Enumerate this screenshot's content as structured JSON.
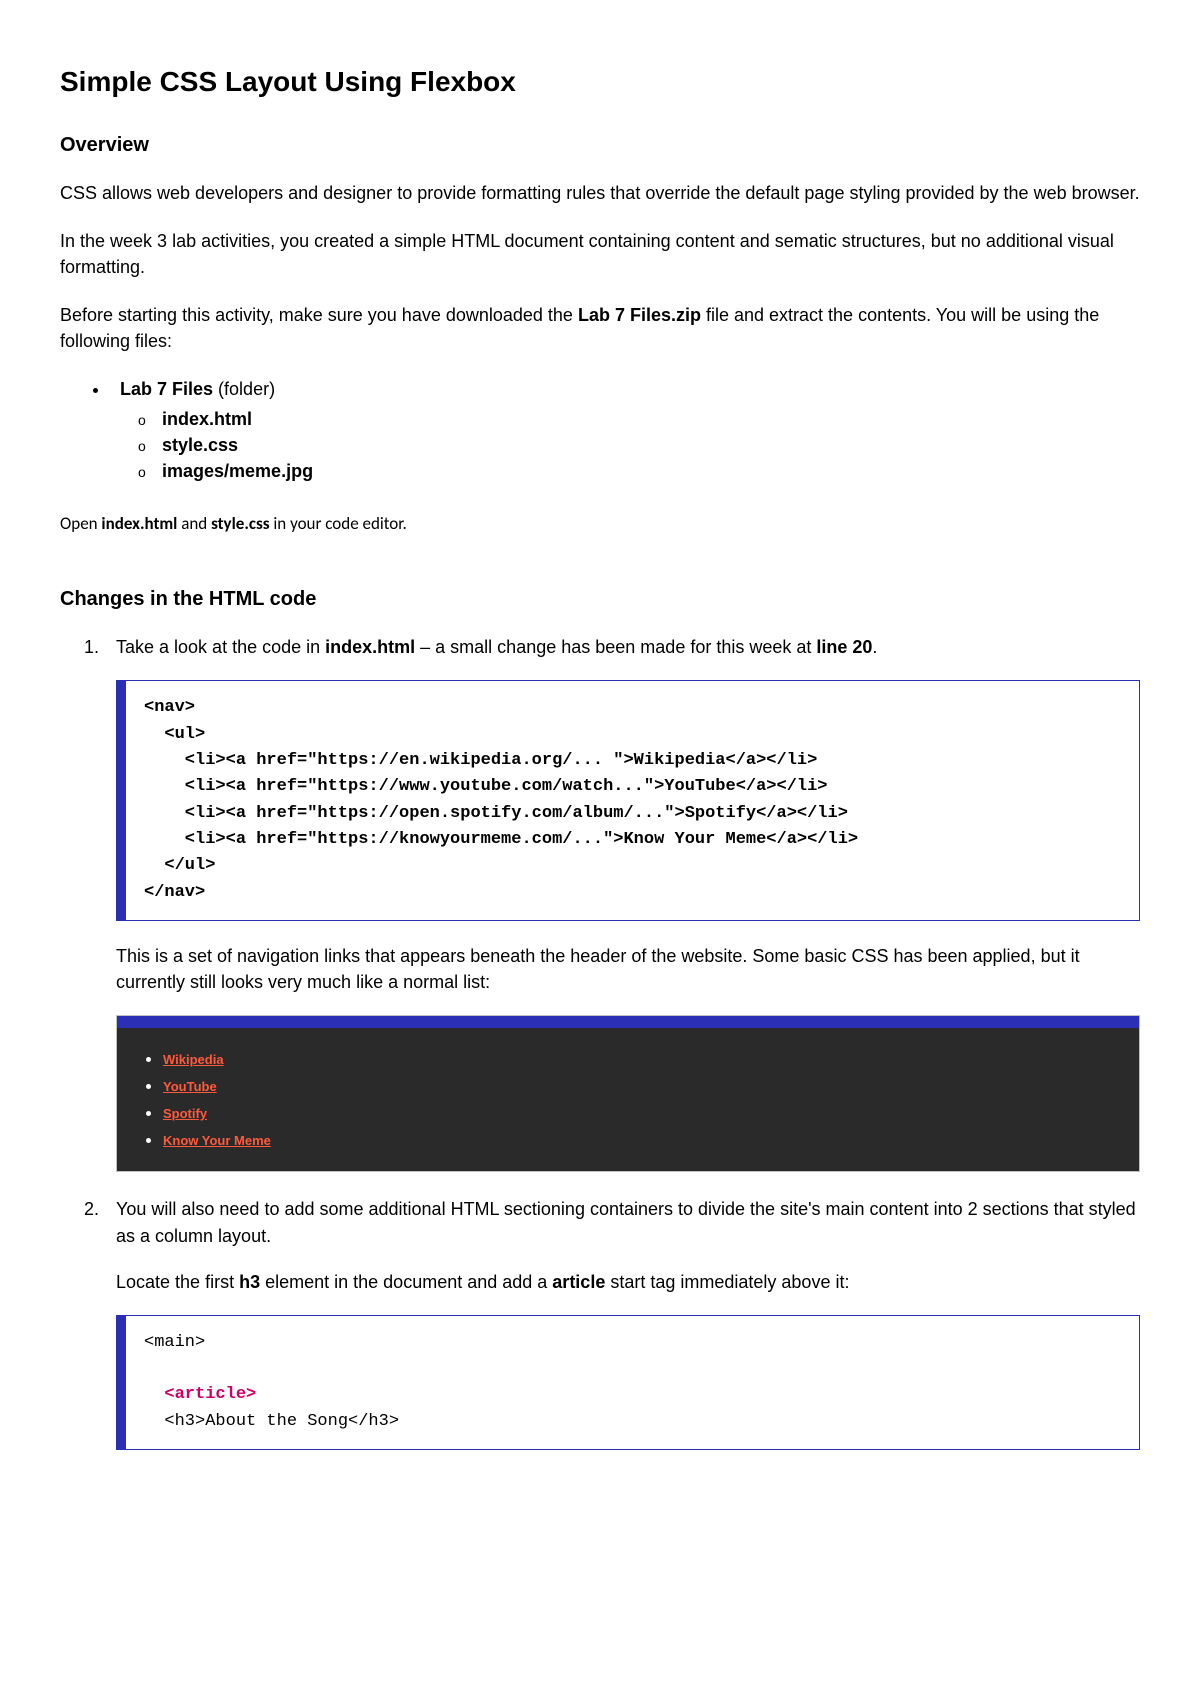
{
  "title": "Simple CSS Layout Using Flexbox",
  "overview": {
    "heading": "Overview",
    "p1": "CSS allows web developers and designer to provide formatting rules that override the default page styling provided by the web browser.",
    "p2": "In the week 3 lab activities, you created a simple HTML document containing content and sematic structures, but no additional visual formatting.",
    "p3_a": "Before starting this activity, make sure you have downloaded the ",
    "p3_b": "Lab 7 Files.zip",
    "p3_c": " file and extract the contents. You will be using the following files:",
    "folder_label": "Lab 7 Files",
    "folder_suffix": " (folder)",
    "file1": "index.html",
    "file2": "style.css",
    "file3": "images/meme.jpg",
    "open_a": "Open ",
    "open_b": "index.html",
    "open_c": " and ",
    "open_d": "style.css",
    "open_e": " in your code editor."
  },
  "changes": {
    "heading": "Changes in the HTML code",
    "step1_a": "Take a look at the code in ",
    "step1_b": "index.html",
    "step1_c": " – a small change has been made for this week at ",
    "step1_d": "line 20",
    "step1_e": ".",
    "code1": "<nav>\n  <ul>\n    <li><a href=\"https://en.wikipedia.org/... \">Wikipedia</a></li>\n    <li><a href=\"https://www.youtube.com/watch...\">YouTube</a></li>\n    <li><a href=\"https://open.spotify.com/album/...\">Spotify</a></li>\n    <li><a href=\"https://knowyourmeme.com/...\">Know Your Meme</a></li>\n  </ul>\n</nav>",
    "step1_after": "This is a set of navigation links that appears beneath the header of the website. Some basic CSS has been applied, but it currently still looks very much like a normal list:",
    "navlinks": {
      "l1": "Wikipedia",
      "l2": "YouTube",
      "l3": "Spotify",
      "l4": "Know Your Meme"
    },
    "step2_p1": "You will also need to add some additional HTML sectioning containers to divide the site's main content into 2 sections that styled as a column layout.",
    "step2_p2_a": "Locate the first ",
    "step2_p2_b": "h3",
    "step2_p2_c": " element in the document and add a ",
    "step2_p2_d": "article",
    "step2_p2_e": " start tag immediately above it:",
    "code2_line1": "<main>",
    "code2_line2": "  <article>",
    "code2_line3": "  <h3>About the Song</h3>"
  }
}
